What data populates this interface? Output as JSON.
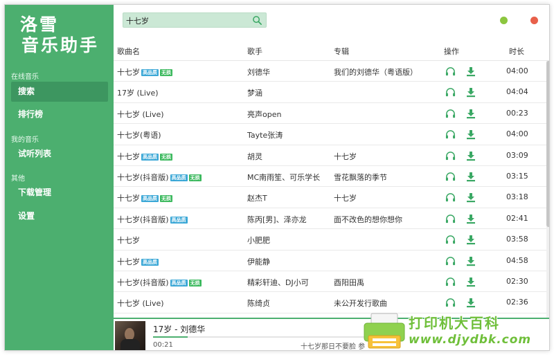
{
  "app": {
    "logo_line1": "洛雪",
    "logo_line2": "音乐助手"
  },
  "sidebar": {
    "sections": [
      {
        "title": "在线音乐",
        "items": [
          {
            "label": "搜索",
            "active": true
          },
          {
            "label": "排行榜",
            "active": false
          }
        ]
      },
      {
        "title": "我的音乐",
        "items": [
          {
            "label": "试听列表",
            "active": false
          }
        ]
      },
      {
        "title": "其他",
        "items": [
          {
            "label": "下载管理",
            "active": false
          },
          {
            "label": "设置",
            "active": false
          }
        ]
      }
    ]
  },
  "search": {
    "value": "十七岁",
    "placeholder": ""
  },
  "window_controls": {
    "minimize_color": "#8cc63f",
    "close_color": "#e8604a"
  },
  "table": {
    "headers": {
      "name": "歌曲名",
      "singer": "歌手",
      "album": "专辑",
      "action": "操作",
      "duration": "时长"
    },
    "badges": {
      "hq": "高品质",
      "lossless": "无损"
    },
    "rows": [
      {
        "name": "十七岁",
        "hq": true,
        "lossless": true,
        "singer": "刘德华",
        "album": "我们的刘德华（粤语版）",
        "duration": "04:00"
      },
      {
        "name": "17岁 (Live)",
        "hq": false,
        "lossless": false,
        "singer": "梦涵",
        "album": "",
        "duration": "04:04"
      },
      {
        "name": "十七岁 (Live)",
        "hq": false,
        "lossless": false,
        "singer": "亮声open",
        "album": "",
        "duration": "00:23"
      },
      {
        "name": "十七岁(粤语)",
        "hq": false,
        "lossless": false,
        "singer": "Tayte张涛",
        "album": "",
        "duration": "04:00"
      },
      {
        "name": "十七岁",
        "hq": true,
        "lossless": true,
        "singer": "胡灵",
        "album": "十七岁",
        "duration": "03:09"
      },
      {
        "name": "十七岁(抖音版)",
        "hq": true,
        "lossless": true,
        "singer": "MC南雨笙、可乐学长",
        "album": "雪花飘落的季节",
        "duration": "03:15"
      },
      {
        "name": "十七岁",
        "hq": true,
        "lossless": true,
        "singer": "赵杰T",
        "album": "十七岁",
        "duration": "03:18"
      },
      {
        "name": "十七岁(抖音版)",
        "hq": true,
        "lossless": false,
        "singer": "陈丙[男]、泽亦龙",
        "album": "面不改色的想你想你",
        "duration": "02:41"
      },
      {
        "name": "十七岁",
        "hq": false,
        "lossless": false,
        "singer": "小肥肥",
        "album": "",
        "duration": "03:58"
      },
      {
        "name": "十七岁",
        "hq": true,
        "lossless": false,
        "singer": "伊能静",
        "album": "",
        "duration": "04:58"
      },
      {
        "name": "十七岁(抖音版)",
        "hq": true,
        "lossless": true,
        "singer": "精彩轩迪、DJ小可",
        "album": "酉阳田禹",
        "duration": "02:30"
      },
      {
        "name": "十七岁 (Live)",
        "hq": false,
        "lossless": false,
        "singer": "陈绮贞",
        "album": "未公开发行歌曲",
        "duration": "02:36"
      }
    ]
  },
  "player": {
    "title": "17岁 - 刘德华",
    "current_time": "00:21",
    "progress": 0.15,
    "lyric": "十七岁那日不要脸 参"
  },
  "watermark": {
    "line1": "打印机大百科",
    "line2": "www.djydbk.com"
  },
  "colors": {
    "accent": "#4caf6f",
    "accent_dark": "#3d9660",
    "hq_badge": "#3aa7d6",
    "lossless_badge": "#3cb95e"
  }
}
